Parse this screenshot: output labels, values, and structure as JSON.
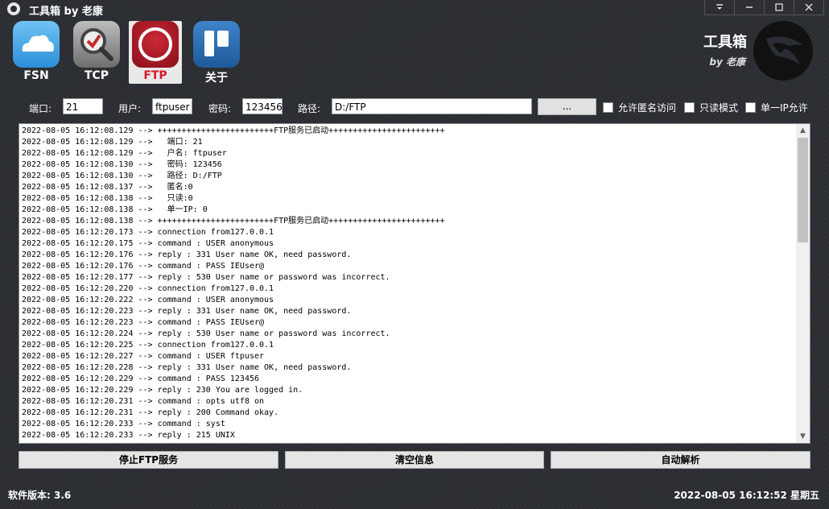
{
  "window": {
    "title": "工具箱 by 老康"
  },
  "toolbar": {
    "tools": [
      {
        "label": "FSN",
        "icon": "cloud-icon"
      },
      {
        "label": "TCP",
        "icon": "check-magnifier-icon"
      },
      {
        "label": "FTP",
        "icon": "ring-icon",
        "active": true
      },
      {
        "label": "关于",
        "icon": "board-icon"
      }
    ]
  },
  "brand": {
    "title": "工具箱",
    "subtitle": "by 老康",
    "logo_icon": "swallow-logo-icon"
  },
  "params": {
    "port_label": "端口:",
    "port_value": "21",
    "user_label": "用户:",
    "user_value": "ftpuser",
    "pass_label": "密码:",
    "pass_value": "123456",
    "path_label": "路径:",
    "path_value": "D:/FTP",
    "browse_label": "...",
    "allow_anon_label": "允许匿名访问",
    "readonly_label": "只读模式",
    "single_ip_label": "单一IP允许"
  },
  "log": {
    "lines": [
      "2022-08-05 16:12:08.129 --> ++++++++++++++++++++++++FTP服务已启动++++++++++++++++++++++++",
      "2022-08-05 16:12:08.129 -->   端口: 21",
      "2022-08-05 16:12:08.129 -->   户名: ftpuser",
      "2022-08-05 16:12:08.130 -->   密码: 123456",
      "2022-08-05 16:12:08.130 -->   路径: D:/FTP",
      "2022-08-05 16:12:08.137 -->   匿名:0",
      "2022-08-05 16:12:08.138 -->   只读:0",
      "2022-08-05 16:12:08.138 -->   单一IP: 0",
      "2022-08-05 16:12:08.138 --> ++++++++++++++++++++++++FTP服务已启动++++++++++++++++++++++++",
      "2022-08-05 16:12:20.173 --> connection from127.0.0.1",
      "2022-08-05 16:12:20.175 --> command : USER anonymous",
      "2022-08-05 16:12:20.176 --> reply : 331 User name OK, need password.",
      "2022-08-05 16:12:20.176 --> command : PASS IEUser@",
      "2022-08-05 16:12:20.177 --> reply : 530 User name or password was incorrect.",
      "2022-08-05 16:12:20.220 --> connection from127.0.0.1",
      "2022-08-05 16:12:20.222 --> command : USER anonymous",
      "2022-08-05 16:12:20.223 --> reply : 331 User name OK, need password.",
      "2022-08-05 16:12:20.223 --> command : PASS IEUser@",
      "2022-08-05 16:12:20.224 --> reply : 530 User name or password was incorrect.",
      "2022-08-05 16:12:20.225 --> connection from127.0.0.1",
      "2022-08-05 16:12:20.227 --> command : USER ftpuser",
      "2022-08-05 16:12:20.228 --> reply : 331 User name OK, need password.",
      "2022-08-05 16:12:20.229 --> command : PASS 123456",
      "2022-08-05 16:12:20.229 --> reply : 230 You are logged in.",
      "2022-08-05 16:12:20.231 --> command : opts utf8 on",
      "2022-08-05 16:12:20.231 --> reply : 200 Command okay.",
      "2022-08-05 16:12:20.233 --> command : syst",
      "2022-08-05 16:12:20.233 --> reply : 215 UNIX"
    ]
  },
  "actions": {
    "stop_label": "停止FTP服务",
    "clear_label": "清空信息",
    "auto_parse_label": "自动解析"
  },
  "status": {
    "version": "软件版本: 3.6",
    "datetime": "2022-08-05 16:12:52 星期五"
  },
  "colors": {
    "active_tool_text": "#d8192a",
    "background": "#2a2d31"
  }
}
